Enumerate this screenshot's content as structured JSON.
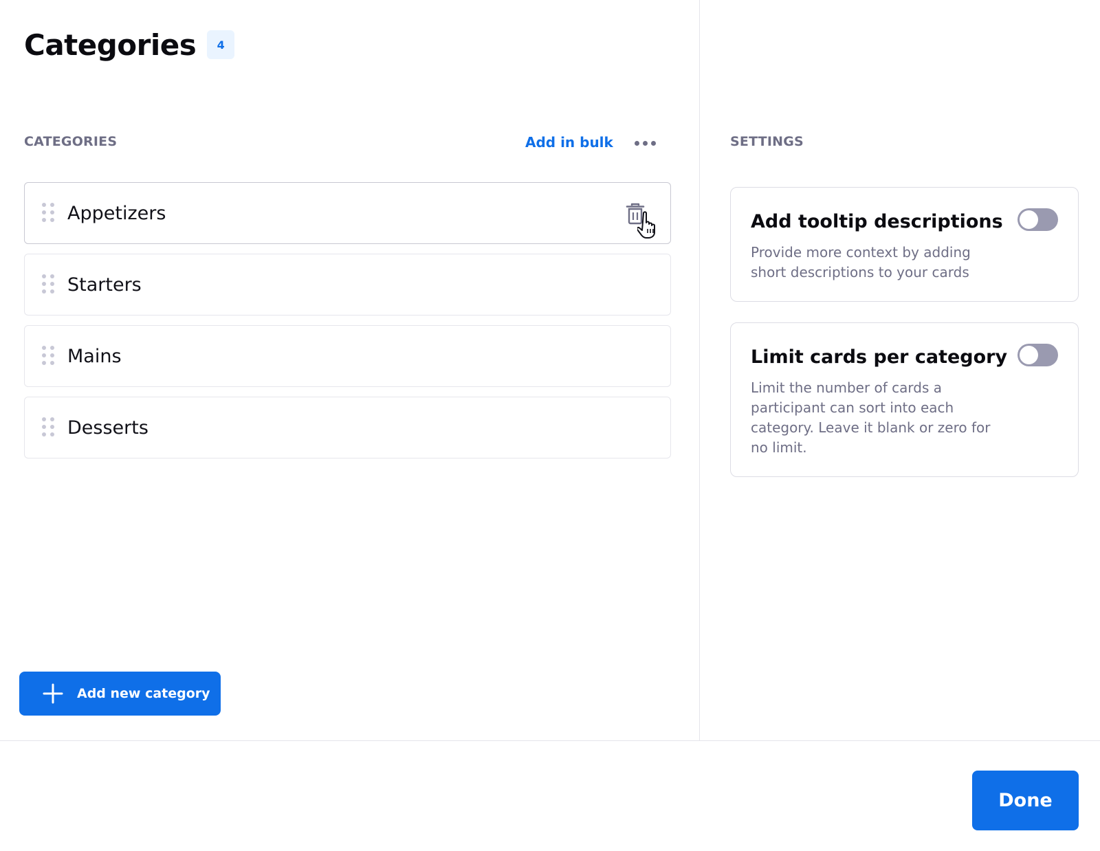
{
  "header": {
    "title": "Categories",
    "count": "4"
  },
  "categories_panel": {
    "section_label": "CATEGORIES",
    "add_in_bulk_label": "Add in bulk",
    "more_icon": "more-horizontal-icon",
    "items": [
      {
        "label": "Appetizers"
      },
      {
        "label": "Starters"
      },
      {
        "label": "Mains"
      },
      {
        "label": "Desserts"
      }
    ],
    "add_button_label": "Add new category"
  },
  "settings_panel": {
    "section_label": "SETTINGS",
    "cards": [
      {
        "title": "Add tooltip descriptions",
        "description": "Provide more context by adding short descriptions to your cards",
        "enabled": false
      },
      {
        "title": "Limit cards per category",
        "description": "Limit the number of cards a participant can sort into each category. Leave it blank or zero for no limit.",
        "enabled": false
      }
    ]
  },
  "footer": {
    "done_label": "Done"
  },
  "colors": {
    "accent": "#0f6fe8",
    "badge_bg": "#eaf4ff",
    "muted_text": "#6e6e85",
    "toggle_off": "#9a9ab0"
  }
}
